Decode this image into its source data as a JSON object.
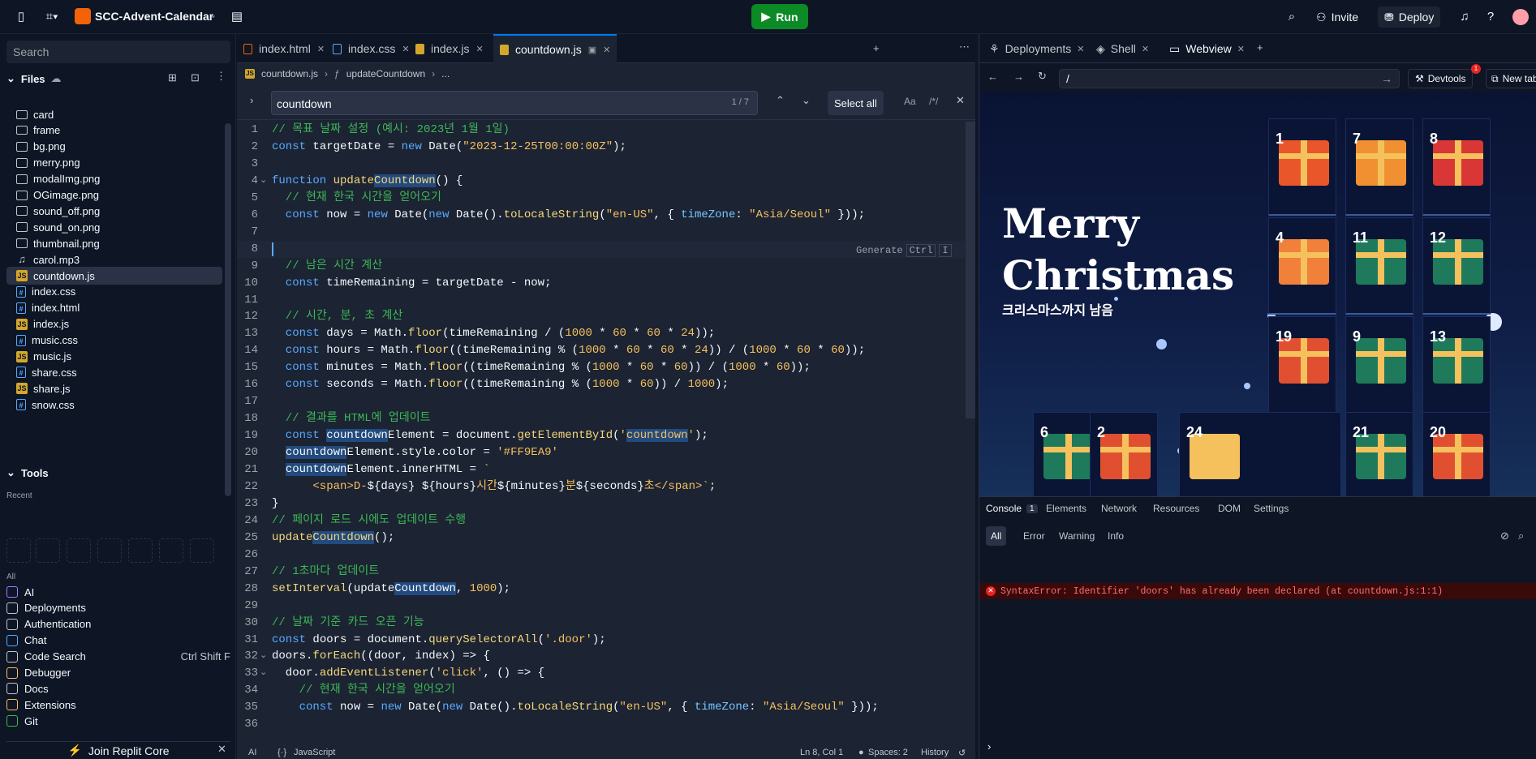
{
  "topbar": {
    "project_name": "SCC-Advent-Calendar",
    "run_label": "Run",
    "invite_label": "Invite",
    "deploy_label": "Deploy"
  },
  "sidebar": {
    "search_placeholder": "Search",
    "files_label": "Files",
    "files": [
      {
        "name": "card",
        "type": "folder"
      },
      {
        "name": "frame",
        "type": "folder"
      },
      {
        "name": "bg.png",
        "type": "image"
      },
      {
        "name": "merry.png",
        "type": "image"
      },
      {
        "name": "modalImg.png",
        "type": "image"
      },
      {
        "name": "OGimage.png",
        "type": "image"
      },
      {
        "name": "sound_off.png",
        "type": "image"
      },
      {
        "name": "sound_on.png",
        "type": "image"
      },
      {
        "name": "thumbnail.png",
        "type": "image"
      },
      {
        "name": "carol.mp3",
        "type": "audio"
      },
      {
        "name": "countdown.js",
        "type": "js"
      },
      {
        "name": "index.css",
        "type": "css"
      },
      {
        "name": "index.html",
        "type": "html"
      },
      {
        "name": "index.js",
        "type": "js"
      },
      {
        "name": "music.css",
        "type": "css"
      },
      {
        "name": "music.js",
        "type": "js"
      },
      {
        "name": "share.css",
        "type": "css"
      },
      {
        "name": "share.js",
        "type": "js"
      },
      {
        "name": "snow.css",
        "type": "css"
      }
    ],
    "tools_label": "Tools",
    "recent_label": "Recent",
    "all_label": "All",
    "tools": [
      {
        "name": "AI",
        "color": "#a77bff"
      },
      {
        "name": "Deployments",
        "color": "#c2c8cc"
      },
      {
        "name": "Authentication",
        "color": "#c2c8cc"
      },
      {
        "name": "Chat",
        "color": "#57abff"
      },
      {
        "name": "Code Search",
        "color": "#c2c8cc",
        "shortcut": "Ctrl Shift F"
      },
      {
        "name": "Debugger",
        "color": "#f5c15d"
      },
      {
        "name": "Docs",
        "color": "#c2c8cc"
      },
      {
        "name": "Extensions",
        "color": "#f5c15d"
      },
      {
        "name": "Git",
        "color": "#3db854"
      }
    ],
    "join_label": "Join Replit Core"
  },
  "editor": {
    "tabs": [
      {
        "label": "index.html",
        "type": "html"
      },
      {
        "label": "index.css",
        "type": "css"
      },
      {
        "label": "index.js",
        "type": "js"
      },
      {
        "label": "countdown.js",
        "type": "js",
        "active": true
      }
    ],
    "breadcrumb_file": "countdown.js",
    "breadcrumb_fn": "updateCountdown",
    "breadcrumb_more": "...",
    "find": {
      "query": "countdown",
      "count": "1 / 7",
      "select_all": "Select all",
      "match_case": "Aa",
      "regex": "/*/"
    },
    "generate_hint": "Generate",
    "generate_key1": "Ctrl",
    "generate_key2": "I",
    "status": {
      "ai": "AI",
      "lang": "JavaScript",
      "position": "Ln 8, Col 1",
      "spaces": "Spaces: 2",
      "history": "History"
    }
  },
  "code_lines": [
    [
      {
        "c": "cm",
        "t": "// 목표 날짜 설정 (예시: 2023년 1월 1일)"
      }
    ],
    [
      {
        "c": "kw",
        "t": "const "
      },
      {
        "c": "nv",
        "t": "targetDate = "
      },
      {
        "c": "kw",
        "t": "new "
      },
      {
        "c": "nv",
        "t": "Date("
      },
      {
        "c": "str",
        "t": "\"2023-12-25T00:00:00Z\""
      },
      {
        "c": "nv",
        "t": ");"
      }
    ],
    [],
    [
      {
        "c": "kw",
        "t": "function "
      },
      {
        "c": "fn",
        "t": "update"
      },
      {
        "c": "hl fn",
        "t": "Countdown"
      },
      {
        "c": "nv",
        "t": "() {"
      }
    ],
    [
      {
        "c": "cm",
        "t": "  // 현재 한국 시간을 얻어오기"
      }
    ],
    [
      {
        "c": "kw",
        "t": "  const "
      },
      {
        "c": "nv",
        "t": "now = "
      },
      {
        "c": "kw",
        "t": "new "
      },
      {
        "c": "nv",
        "t": "Date("
      },
      {
        "c": "kw",
        "t": "new "
      },
      {
        "c": "nv",
        "t": "Date()."
      },
      {
        "c": "fn",
        "t": "toLocaleString"
      },
      {
        "c": "nv",
        "t": "("
      },
      {
        "c": "str",
        "t": "\"en-US\""
      },
      {
        "c": "nv",
        "t": ", { "
      },
      {
        "c": "pr",
        "t": "timeZone"
      },
      {
        "c": "nv",
        "t": ": "
      },
      {
        "c": "str",
        "t": "\"Asia/Seoul\""
      },
      {
        "c": "nv",
        "t": " }));"
      }
    ],
    [],
    [],
    [
      {
        "c": "cm",
        "t": "  // 남은 시간 계산"
      }
    ],
    [
      {
        "c": "kw",
        "t": "  const "
      },
      {
        "c": "nv",
        "t": "timeRemaining = targetDate - now;"
      }
    ],
    [],
    [
      {
        "c": "cm",
        "t": "  // 시간, 분, 초 계산"
      }
    ],
    [
      {
        "c": "kw",
        "t": "  const "
      },
      {
        "c": "nv",
        "t": "days = Math."
      },
      {
        "c": "fn",
        "t": "floor"
      },
      {
        "c": "nv",
        "t": "(timeRemaining / ("
      },
      {
        "c": "nm",
        "t": "1000"
      },
      {
        "c": "nv",
        "t": " * "
      },
      {
        "c": "nm",
        "t": "60"
      },
      {
        "c": "nv",
        "t": " * "
      },
      {
        "c": "nm",
        "t": "60"
      },
      {
        "c": "nv",
        "t": " * "
      },
      {
        "c": "nm",
        "t": "24"
      },
      {
        "c": "nv",
        "t": "));"
      }
    ],
    [
      {
        "c": "kw",
        "t": "  const "
      },
      {
        "c": "nv",
        "t": "hours = Math."
      },
      {
        "c": "fn",
        "t": "floor"
      },
      {
        "c": "nv",
        "t": "((timeRemaining % ("
      },
      {
        "c": "nm",
        "t": "1000"
      },
      {
        "c": "nv",
        "t": " * "
      },
      {
        "c": "nm",
        "t": "60"
      },
      {
        "c": "nv",
        "t": " * "
      },
      {
        "c": "nm",
        "t": "60"
      },
      {
        "c": "nv",
        "t": " * "
      },
      {
        "c": "nm",
        "t": "24"
      },
      {
        "c": "nv",
        "t": ")) / ("
      },
      {
        "c": "nm",
        "t": "1000"
      },
      {
        "c": "nv",
        "t": " * "
      },
      {
        "c": "nm",
        "t": "60"
      },
      {
        "c": "nv",
        "t": " * "
      },
      {
        "c": "nm",
        "t": "60"
      },
      {
        "c": "nv",
        "t": "));"
      }
    ],
    [
      {
        "c": "kw",
        "t": "  const "
      },
      {
        "c": "nv",
        "t": "minutes = Math."
      },
      {
        "c": "fn",
        "t": "floor"
      },
      {
        "c": "nv",
        "t": "((timeRemaining % ("
      },
      {
        "c": "nm",
        "t": "1000"
      },
      {
        "c": "nv",
        "t": " * "
      },
      {
        "c": "nm",
        "t": "60"
      },
      {
        "c": "nv",
        "t": " * "
      },
      {
        "c": "nm",
        "t": "60"
      },
      {
        "c": "nv",
        "t": ")) / ("
      },
      {
        "c": "nm",
        "t": "1000"
      },
      {
        "c": "nv",
        "t": " * "
      },
      {
        "c": "nm",
        "t": "60"
      },
      {
        "c": "nv",
        "t": "));"
      }
    ],
    [
      {
        "c": "kw",
        "t": "  const "
      },
      {
        "c": "nv",
        "t": "seconds = Math."
      },
      {
        "c": "fn",
        "t": "floor"
      },
      {
        "c": "nv",
        "t": "((timeRemaining % ("
      },
      {
        "c": "nm",
        "t": "1000"
      },
      {
        "c": "nv",
        "t": " * "
      },
      {
        "c": "nm",
        "t": "60"
      },
      {
        "c": "nv",
        "t": ")) / "
      },
      {
        "c": "nm",
        "t": "1000"
      },
      {
        "c": "nv",
        "t": ");"
      }
    ],
    [],
    [
      {
        "c": "cm",
        "t": "  // 결과를 HTML에 업데이트"
      }
    ],
    [
      {
        "c": "kw",
        "t": "  const "
      },
      {
        "c": "hl nv",
        "t": "countdown"
      },
      {
        "c": "nv",
        "t": "Element = document."
      },
      {
        "c": "fn",
        "t": "getElementById"
      },
      {
        "c": "nv",
        "t": "("
      },
      {
        "c": "str",
        "t": "'"
      },
      {
        "c": "hl str",
        "t": "countdown"
      },
      {
        "c": "str",
        "t": "'"
      },
      {
        "c": "nv",
        "t": ");"
      }
    ],
    [
      {
        "c": "nv",
        "t": "  "
      },
      {
        "c": "hl nv",
        "t": "countdown"
      },
      {
        "c": "nv",
        "t": "Element.style.color = "
      },
      {
        "c": "str",
        "t": "'#FF9EA9'"
      }
    ],
    [
      {
        "c": "nv",
        "t": "  "
      },
      {
        "c": "hl nv",
        "t": "countdown"
      },
      {
        "c": "nv",
        "t": "Element.innerHTML = "
      },
      {
        "c": "str",
        "t": "`"
      }
    ],
    [
      {
        "c": "str",
        "t": "      <span>D-"
      },
      {
        "c": "nv",
        "t": "${days}"
      },
      {
        "c": "str",
        "t": " "
      },
      {
        "c": "nv",
        "t": "${hours}"
      },
      {
        "c": "str",
        "t": "시간"
      },
      {
        "c": "nv",
        "t": "${minutes}"
      },
      {
        "c": "str",
        "t": "분"
      },
      {
        "c": "nv",
        "t": "${seconds}"
      },
      {
        "c": "str",
        "t": "초</span>`"
      },
      {
        "c": "nv",
        "t": ";"
      }
    ],
    [
      {
        "c": "nv",
        "t": "}"
      }
    ],
    [
      {
        "c": "cm",
        "t": "// 페이지 로드 시에도 업데이트 수행"
      }
    ],
    [
      {
        "c": "fn",
        "t": "update"
      },
      {
        "c": "hl fn",
        "t": "Countdown"
      },
      {
        "c": "nv",
        "t": "();"
      }
    ],
    [],
    [
      {
        "c": "cm",
        "t": "// 1초마다 업데이트"
      }
    ],
    [
      {
        "c": "fn",
        "t": "setInterval"
      },
      {
        "c": "nv",
        "t": "(update"
      },
      {
        "c": "hl nv",
        "t": "Countdown"
      },
      {
        "c": "nv",
        "t": ", "
      },
      {
        "c": "nm",
        "t": "1000"
      },
      {
        "c": "nv",
        "t": ");"
      }
    ],
    [],
    [
      {
        "c": "cm",
        "t": "// 날짜 기준 카드 오픈 기능"
      }
    ],
    [
      {
        "c": "kw",
        "t": "const "
      },
      {
        "c": "nv",
        "t": "doors = document."
      },
      {
        "c": "fn",
        "t": "querySelectorAll"
      },
      {
        "c": "nv",
        "t": "("
      },
      {
        "c": "str",
        "t": "'.door'"
      },
      {
        "c": "nv",
        "t": ");"
      }
    ],
    [
      {
        "c": "nv",
        "t": "doors."
      },
      {
        "c": "fn",
        "t": "forEach"
      },
      {
        "c": "nv",
        "t": "((door, index) => {"
      }
    ],
    [
      {
        "c": "nv",
        "t": "  door."
      },
      {
        "c": "fn",
        "t": "addEventListener"
      },
      {
        "c": "nv",
        "t": "("
      },
      {
        "c": "str",
        "t": "'click'"
      },
      {
        "c": "nv",
        "t": ", () => {"
      }
    ],
    [
      {
        "c": "cm",
        "t": "    // 현재 한국 시간을 얻어오기"
      }
    ],
    [
      {
        "c": "kw",
        "t": "    const "
      },
      {
        "c": "nv",
        "t": "now = "
      },
      {
        "c": "kw",
        "t": "new "
      },
      {
        "c": "nv",
        "t": "Date("
      },
      {
        "c": "kw",
        "t": "new "
      },
      {
        "c": "nv",
        "t": "Date()."
      },
      {
        "c": "fn",
        "t": "toLocaleString"
      },
      {
        "c": "nv",
        "t": "("
      },
      {
        "c": "str",
        "t": "\"en-US\""
      },
      {
        "c": "nv",
        "t": ", { "
      },
      {
        "c": "pr",
        "t": "timeZone"
      },
      {
        "c": "nv",
        "t": ": "
      },
      {
        "c": "str",
        "t": "\"Asia/Seoul\""
      },
      {
        "c": "nv",
        "t": " }));"
      }
    ],
    []
  ],
  "right": {
    "tabs": [
      "Deployments",
      "Shell",
      "Webview"
    ],
    "url": "/",
    "devtools_label": "Devtools",
    "devtools_badge": "1",
    "newtab_label": "New tab",
    "web": {
      "title_line1": "Merry",
      "title_line2": "Christmas",
      "subtitle": "크리스마스까지 남음",
      "cards": [
        "1",
        "7",
        "8",
        "4",
        "11",
        "12",
        "19",
        "9",
        "13",
        "6",
        "2",
        "24",
        "21",
        "20"
      ]
    },
    "devpanel": {
      "tabs": [
        "Console",
        "Elements",
        "Network",
        "Resources",
        "DOM",
        "Settings"
      ],
      "console_count": "1",
      "filters": [
        "All",
        "Error",
        "Warning",
        "Info"
      ],
      "error": "SyntaxError: Identifier 'doors' has already been declared (at countdown.js:1:1)"
    }
  }
}
